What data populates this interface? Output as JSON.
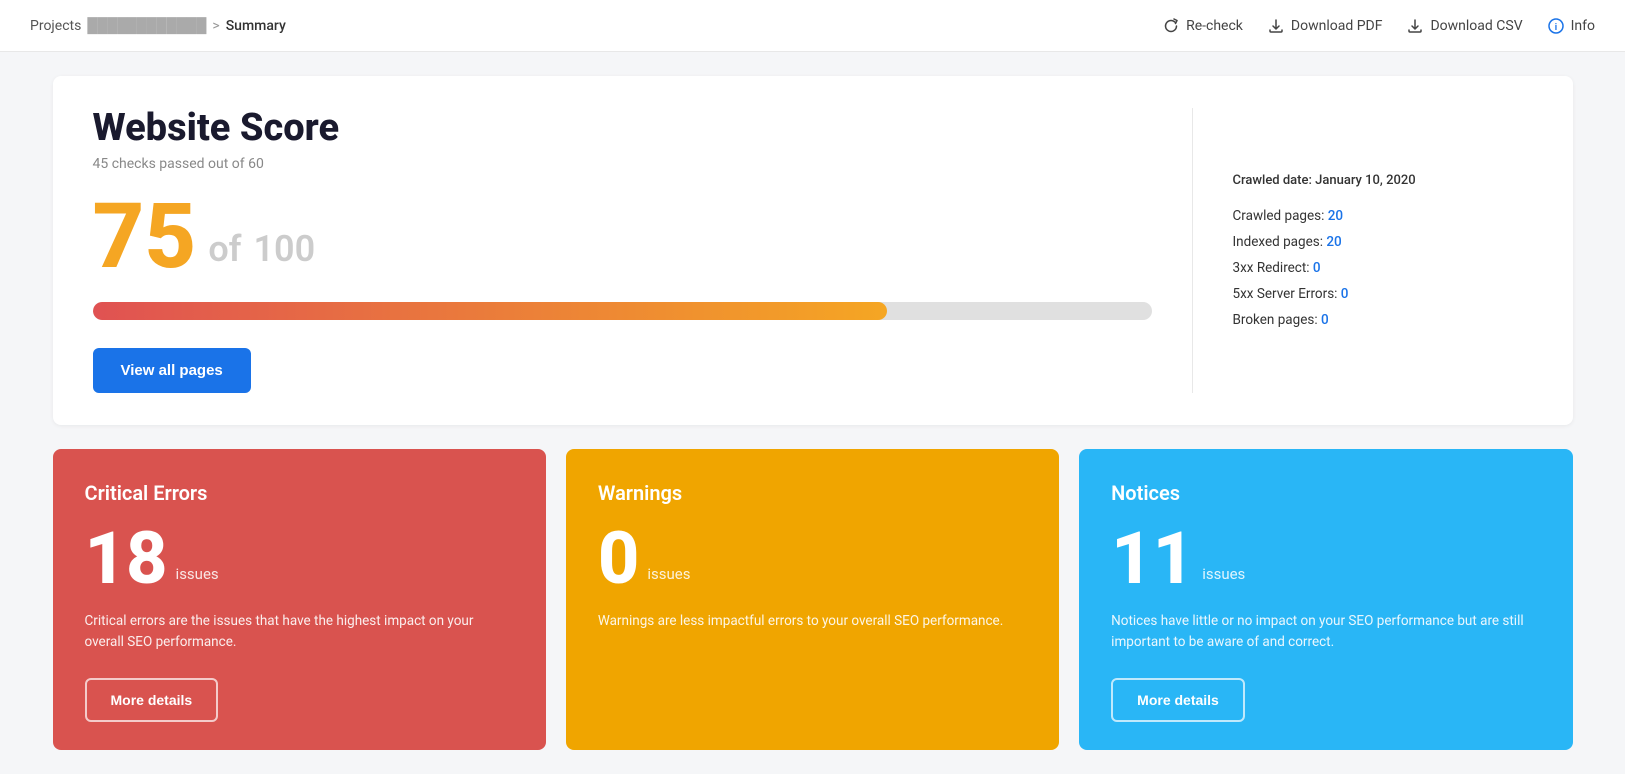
{
  "header": {
    "breadcrumb_projects": "Projects",
    "breadcrumb_domain": "████████████",
    "breadcrumb_separator": ">",
    "breadcrumb_current": "Summary",
    "action_recheck": "Re-check",
    "action_download_pdf": "Download PDF",
    "action_download_csv": "Download CSV",
    "action_info": "Info"
  },
  "score_card": {
    "title": "Website Score",
    "subtitle": "45 checks passed out of 60",
    "score": "75",
    "of_label": "of",
    "max_score": "100",
    "progress_percent": 75,
    "view_all_label": "View all pages",
    "crawled_date_label": "Crawled date:",
    "crawled_date_value": "January 10, 2020",
    "stats": [
      {
        "label": "Crawled pages:",
        "value": "20",
        "key": "crawled_pages"
      },
      {
        "label": "Indexed pages:",
        "value": "20",
        "key": "indexed_pages"
      },
      {
        "label": "3xx Redirect:",
        "value": "0",
        "key": "redirect"
      },
      {
        "label": "5xx Server Errors:",
        "value": "0",
        "key": "server_errors"
      },
      {
        "label": "Broken pages:",
        "value": "0",
        "key": "broken_pages"
      }
    ]
  },
  "cards": [
    {
      "id": "critical-errors",
      "title": "Critical Errors",
      "count": "18",
      "count_label": "issues",
      "description": "Critical errors are the issues that have the highest impact on your overall SEO performance.",
      "button_label": "More details",
      "color": "red"
    },
    {
      "id": "warnings",
      "title": "Warnings",
      "count": "0",
      "count_label": "issues",
      "description": "Warnings are less impactful errors to your overall SEO performance.",
      "button_label": null,
      "color": "orange"
    },
    {
      "id": "notices",
      "title": "Notices",
      "count": "11",
      "count_label": "issues",
      "description": "Notices have little or no impact on your SEO performance but are still important to be aware of and correct.",
      "button_label": "More details",
      "color": "blue"
    }
  ]
}
